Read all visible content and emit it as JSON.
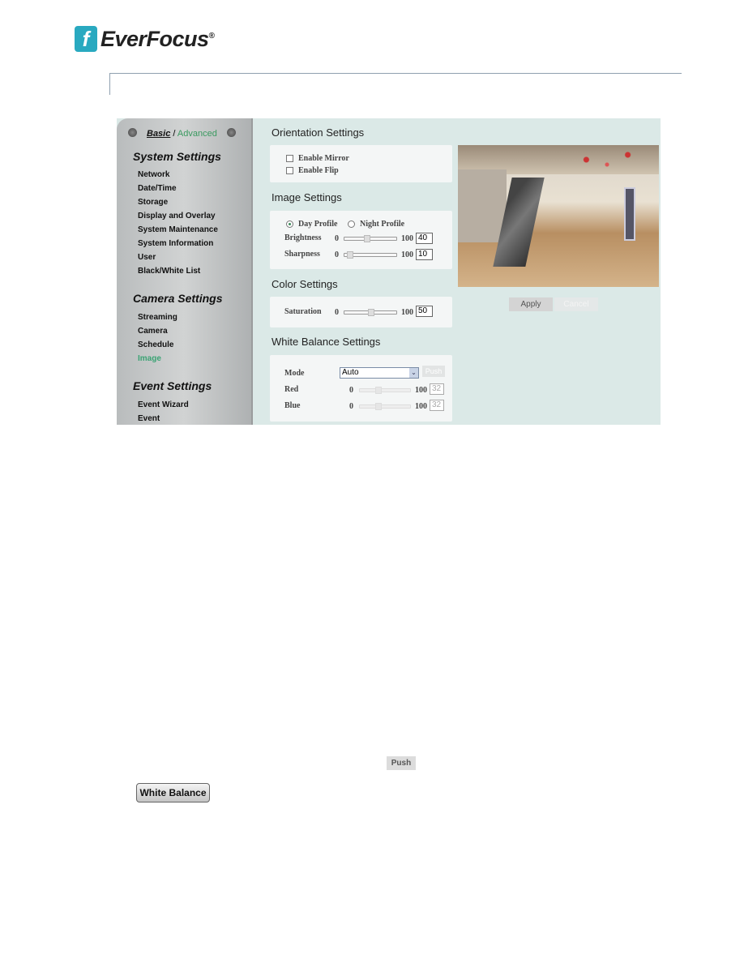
{
  "brand": {
    "name": "EverFocus",
    "registered": "®"
  },
  "sidebar": {
    "mode_basic": "Basic",
    "mode_sep": " / ",
    "mode_advanced": "Advanced",
    "sections": [
      {
        "title": "System Settings",
        "items": [
          "Network",
          "Date/Time",
          "Storage",
          "Display and Overlay",
          "System Maintenance",
          "System Information",
          "User",
          "Black/White List"
        ]
      },
      {
        "title": "Camera Settings",
        "items": [
          "Streaming",
          "Camera",
          "Schedule",
          "Image"
        ]
      },
      {
        "title": "Event Settings",
        "items": [
          "Event Wizard",
          "Event"
        ]
      }
    ],
    "active_item": "Image",
    "active_color": "#3aa374"
  },
  "orientation": {
    "title": "Orientation Settings",
    "mirror": "Enable Mirror",
    "flip": "Enable Flip",
    "mirror_checked": false,
    "flip_checked": false
  },
  "image": {
    "title": "Image Settings",
    "day": "Day Profile",
    "night": "Night Profile",
    "selected": "Day Profile",
    "brightness": {
      "label": "Brightness",
      "min": "0",
      "max": "100",
      "value": "40"
    },
    "sharpness": {
      "label": "Sharpness",
      "min": "0",
      "max": "100",
      "value": "10"
    }
  },
  "color": {
    "title": "Color Settings",
    "saturation": {
      "label": "Saturation",
      "min": "0",
      "max": "100",
      "value": "50"
    }
  },
  "wb": {
    "title": "White Balance Settings",
    "mode_label": "Mode",
    "mode_value": "Auto",
    "push": "Push",
    "red": {
      "label": "Red",
      "min": "0",
      "max": "100",
      "value": "32"
    },
    "blue": {
      "label": "Blue",
      "min": "0",
      "max": "100",
      "value": "32"
    }
  },
  "actions": {
    "apply": "Apply",
    "cancel": "Cancel"
  },
  "doc": {
    "push_button": "Push",
    "white_balance_button": "White Balance"
  }
}
